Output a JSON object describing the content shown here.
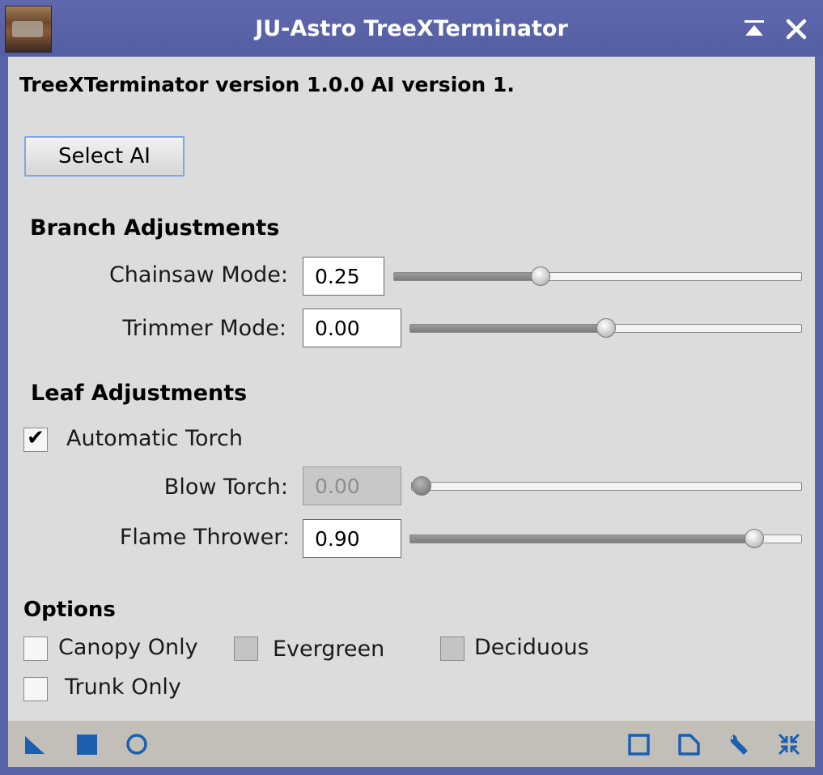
{
  "window": {
    "title": "JU-Astro TreeXTerminator",
    "shade_icon": "shade-icon",
    "close_icon": "close-icon",
    "app_icon": "app-icon"
  },
  "header": {
    "version_text": "TreeXTerminator version 1.0.0 AI version 1.",
    "select_ai_label": "Select AI"
  },
  "branch": {
    "title": "Branch Adjustments",
    "chainsaw": {
      "label": "Chainsaw Mode:",
      "value": "0.25",
      "slider_fraction": 0.36
    },
    "trimmer": {
      "label": "Trimmer Mode:",
      "value": "0.00",
      "slider_fraction": 0.5
    }
  },
  "leaf": {
    "title": "Leaf Adjustments",
    "auto_torch": {
      "label": "Automatic Torch",
      "checked": true
    },
    "blow_torch": {
      "label": "Blow Torch:",
      "value": "0.00",
      "slider_fraction": 0.0,
      "disabled": true
    },
    "flame_thrower": {
      "label": "Flame Thrower:",
      "value": "0.90",
      "slider_fraction": 0.9
    }
  },
  "options": {
    "title": "Options",
    "canopy_only": {
      "label": "Canopy Only",
      "checked": false
    },
    "evergreen": {
      "label": "Evergreen",
      "checked": false,
      "disabled": true
    },
    "deciduous": {
      "label": "Deciduous",
      "checked": false,
      "disabled": true
    },
    "trunk_only": {
      "label": "Trunk Only",
      "checked": false
    }
  },
  "bottom_bar": {
    "left_icons": [
      "new-instance-icon",
      "apply-square-icon",
      "apply-global-circle-icon"
    ],
    "right_icons": [
      "reset-icon",
      "browse-documentation-icon",
      "preferences-wrench-icon",
      "track-view-icon"
    ],
    "accent_color": "#1c5fb0"
  },
  "colors": {
    "titlebar": "#5a64a8",
    "panel": "#dcdcdc",
    "button_border": "#7ea6e0"
  }
}
